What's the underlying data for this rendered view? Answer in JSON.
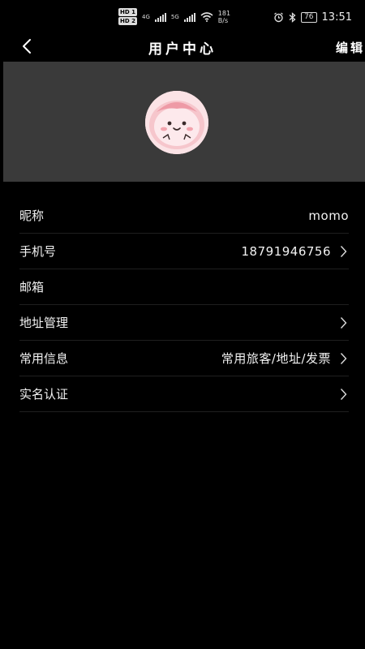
{
  "status_bar": {
    "hd1": "HD 1",
    "hd2": "HD 2",
    "net4g": "4G",
    "net5g": "5G",
    "speed_value": "181",
    "speed_unit": "B/s",
    "battery": "76",
    "time": "13:51"
  },
  "header": {
    "title": "用户中心",
    "edit_label": "编辑",
    "back_icon": "chevron-left-icon"
  },
  "profile": {
    "avatar_icon": "avatar-cartoon"
  },
  "rows": [
    {
      "label": "昵称",
      "value": "momo",
      "chevron": false
    },
    {
      "label": "手机号",
      "value": "18791946756",
      "chevron": true
    },
    {
      "label": "邮箱",
      "value": "",
      "chevron": false
    },
    {
      "label": "地址管理",
      "value": "",
      "chevron": true
    },
    {
      "label": "常用信息",
      "value": "常用旅客/地址/发票",
      "chevron": true
    },
    {
      "label": "实名认证",
      "value": "",
      "chevron": true
    }
  ],
  "colors": {
    "background": "#000000",
    "banner": "#3a3a3a",
    "text": "#f2f2f2",
    "avatar_bg": "#fbe3e6"
  }
}
